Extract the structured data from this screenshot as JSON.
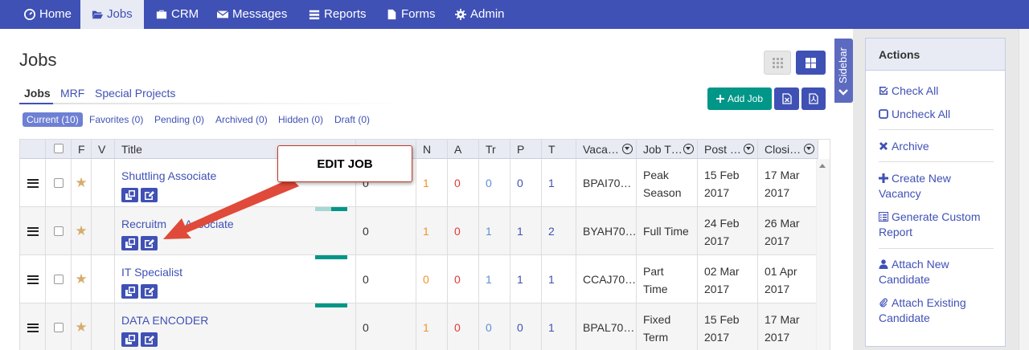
{
  "nav": {
    "items": [
      {
        "label": "Home",
        "icon": "dashboard-icon"
      },
      {
        "label": "Jobs",
        "icon": "folder-open-icon"
      },
      {
        "label": "CRM",
        "icon": "briefcase-icon"
      },
      {
        "label": "Messages",
        "icon": "envelope-icon"
      },
      {
        "label": "Reports",
        "icon": "list-icon"
      },
      {
        "label": "Forms",
        "icon": "file-icon"
      },
      {
        "label": "Admin",
        "icon": "gear-icon"
      }
    ],
    "active": "Jobs",
    "bg_color": "#3f51b5"
  },
  "page": {
    "title": "Jobs"
  },
  "tabs": [
    "Jobs",
    "MRF",
    "Special Projects"
  ],
  "filters": [
    "Current (10)",
    "Favorites (0)",
    "Pending (0)",
    "Archived (0)",
    "Hidden (0)",
    "Draft (0)"
  ],
  "toolbar": {
    "add_job_label": "Add Job",
    "add_job_color": "#009688"
  },
  "table": {
    "headers": [
      "F",
      "V",
      "Title",
      "N",
      "A",
      "Tr",
      "P",
      "T",
      "Vaca…",
      "Job T…",
      "Post …",
      "Closi…"
    ],
    "rows": [
      {
        "title": "Shuttling Associate",
        "c1": "0",
        "n": "1",
        "a": "0",
        "tr": "0",
        "p": "0",
        "t": "1",
        "vac": "BPAI70…",
        "jt": "Peak Season",
        "jt1": "Peak",
        "jt2": "Season",
        "post1": "15 Feb",
        "post2": "2017",
        "close1": "17 Mar",
        "close2": "2017"
      },
      {
        "title": "Recruitment Associate",
        "title_visible": "Recruitm",
        "title_tail": "Associate",
        "c1": "0",
        "n": "1",
        "a": "0",
        "tr": "1",
        "p": "1",
        "t": "2",
        "vac": "BYAH70…",
        "jt1": "Full Time",
        "jt2": "",
        "post1": "24 Feb",
        "post2": "2017",
        "close1": "26 Mar",
        "close2": "2017"
      },
      {
        "title": "IT Specialist",
        "c1": "0",
        "n": "0",
        "a": "0",
        "tr": "1",
        "p": "1",
        "t": "1",
        "vac": "CCAJ70…",
        "jt1": "Part",
        "jt2": "Time",
        "post1": "02 Mar",
        "post2": "2017",
        "close1": "01 Apr",
        "close2": "2017"
      },
      {
        "title": "DATA ENCODER",
        "c1": "0",
        "n": "1",
        "a": "0",
        "tr": "0",
        "p": "0",
        "t": "1",
        "vac": "BPAL70…",
        "jt1": "Fixed",
        "jt2": "Term",
        "post1": "15 Feb",
        "post2": "2017",
        "close1": "17 Mar",
        "close2": "2017"
      }
    ],
    "colors": {
      "n": "#f0932b",
      "a": "#e53935",
      "tr": "#5c8fd6",
      "star": "#d5ad6d"
    }
  },
  "callout": {
    "text": "EDIT JOB",
    "arrow_color": "#e04a3a"
  },
  "sidebar": {
    "tab_label": "Sidebar"
  },
  "actions": {
    "title": "Actions",
    "items": [
      {
        "label": "Check All",
        "icon": "check-square-icon"
      },
      {
        "label": "Uncheck All",
        "icon": "square-icon"
      },
      {
        "label": "Archive",
        "icon": "x-icon"
      },
      {
        "label": "Create New Vacancy",
        "l1": "Create New",
        "l2": "Vacancy",
        "icon": "plus-icon"
      },
      {
        "label": "Generate Custom Report",
        "l1": "Generate Custom",
        "l2": "Report",
        "icon": "list-alt-icon"
      },
      {
        "label": "Attach New Candidate",
        "l1": "Attach New",
        "l2": "Candidate",
        "icon": "user-icon"
      },
      {
        "label": "Attach Existing Candidate",
        "l1": "Attach Existing",
        "l2": "Candidate",
        "icon": "paperclip-icon"
      }
    ]
  }
}
